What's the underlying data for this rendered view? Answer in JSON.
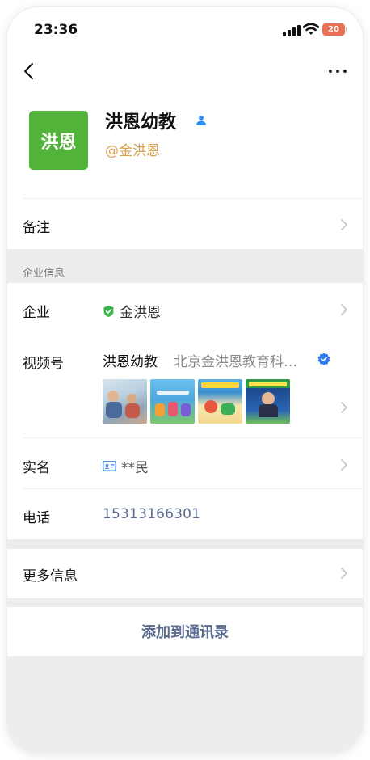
{
  "status_bar": {
    "time": "23:36",
    "battery": "20"
  },
  "profile": {
    "logo_text": "洪恩",
    "name": "洪恩幼教",
    "handle": "@金洪恩"
  },
  "remark": {
    "label": "备注"
  },
  "company_section": {
    "title": "企业信息",
    "company": {
      "label": "企业",
      "value": "金洪恩"
    },
    "channels": {
      "label": "视频号",
      "name": "洪恩幼教",
      "org": "北京金洪恩教育科技有限公司",
      "thumbnails": [
        "thumb-1",
        "thumb-2",
        "thumb-3",
        "thumb-4"
      ]
    },
    "realname": {
      "label": "实名",
      "value": "**民"
    },
    "phone": {
      "label": "电话",
      "value": "15313166301"
    }
  },
  "more_info": {
    "label": "更多信息"
  },
  "add_contact": {
    "label": "添加到通讯录"
  },
  "colors": {
    "logo_bg": "#52b33a",
    "handle": "#d8a24a",
    "link": "#5a6b8f",
    "verified_green": "#39b54a",
    "verified_blue": "#2f7cf6",
    "battery": "#e96f55"
  }
}
